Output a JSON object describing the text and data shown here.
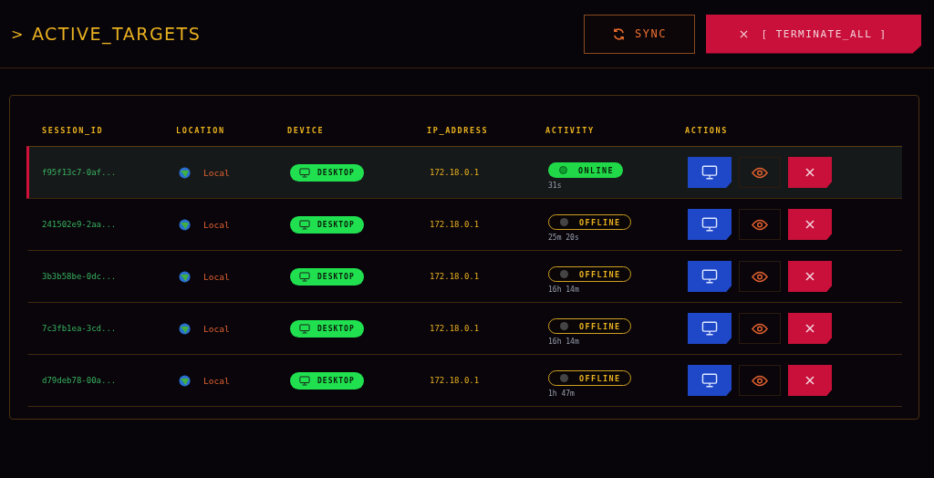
{
  "header": {
    "prompt": ">",
    "title": "ACTIVE_TARGETS",
    "buttons": [
      {
        "kind": "sync",
        "label": "SYNC"
      },
      {
        "kind": "terminate",
        "label": "[ TERMINATE_ALL ]"
      }
    ]
  },
  "table": {
    "columns": [
      "SESSION_ID",
      "LOCATION",
      "DEVICE",
      "IP_ADDRESS",
      "ACTIVITY",
      "ACTIONS"
    ],
    "rows": [
      {
        "session_id": "f95f13c7-0af...",
        "location": "Local",
        "device": "DESKTOP",
        "ip": "172.18.0.1",
        "online": true,
        "status": "ONLINE",
        "duration": "31s",
        "selected": true
      },
      {
        "session_id": "241502e9-2aa...",
        "location": "Local",
        "device": "DESKTOP",
        "ip": "172.18.0.1",
        "online": false,
        "status": "OFFLINE",
        "duration": "25m 20s",
        "selected": false
      },
      {
        "session_id": "3b3b58be-0dc...",
        "location": "Local",
        "device": "DESKTOP",
        "ip": "172.18.0.1",
        "online": false,
        "status": "OFFLINE",
        "duration": "16h 14m",
        "selected": false
      },
      {
        "session_id": "7c3fb1ea-3cd...",
        "location": "Local",
        "device": "DESKTOP",
        "ip": "172.18.0.1",
        "online": false,
        "status": "OFFLINE",
        "duration": "16h 14m",
        "selected": false
      },
      {
        "session_id": "d79deb78-00a...",
        "location": "Local",
        "device": "DESKTOP",
        "ip": "172.18.0.1",
        "online": false,
        "status": "OFFLINE",
        "duration": "1h 47m",
        "selected": false
      }
    ]
  }
}
